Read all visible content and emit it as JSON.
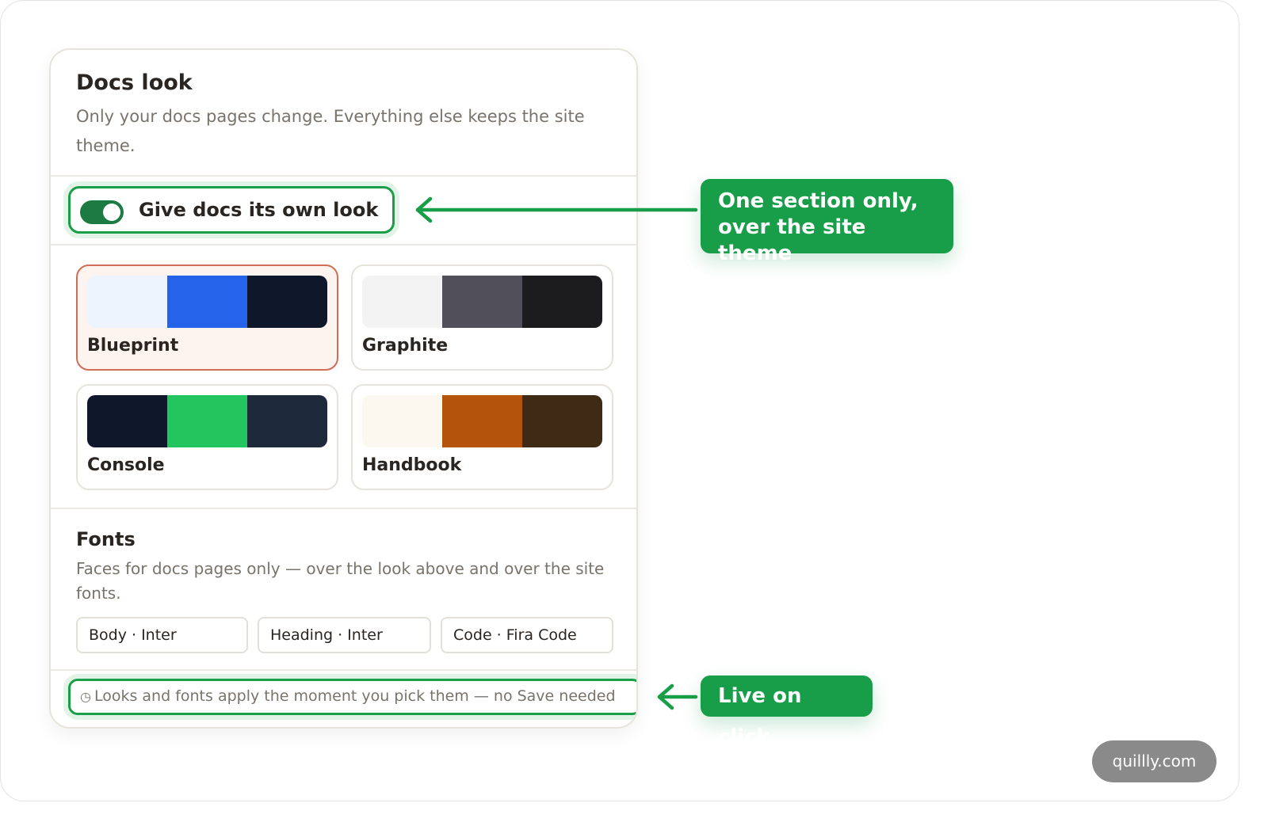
{
  "panel": {
    "title": "Docs look",
    "description": "Only your docs pages change. Everything else keeps the site theme.",
    "toggle_label": "Give docs its own look",
    "toggle_on": true
  },
  "looks": [
    {
      "name": "Blueprint",
      "selected": true,
      "colors": [
        "#eef4fe",
        "#2563eb",
        "#0f172a"
      ]
    },
    {
      "name": "Graphite",
      "selected": false,
      "colors": [
        "#f3f3f3",
        "#51505a",
        "#1c1c1e"
      ]
    },
    {
      "name": "Console",
      "selected": false,
      "colors": [
        "#0f172a",
        "#22c55e",
        "#1e293b"
      ]
    },
    {
      "name": "Handbook",
      "selected": false,
      "colors": [
        "#fdf8ef",
        "#b4530a",
        "#3f2a15"
      ]
    }
  ],
  "fonts": {
    "title": "Fonts",
    "description": "Faces for docs pages only — over the look above and over the site fonts.",
    "chips": [
      "Body · Inter",
      "Heading · Inter",
      "Code · Fira Code"
    ]
  },
  "note": {
    "icon": "clock-icon",
    "glyph": "◷",
    "text": "Looks and fonts apply the moment you pick them — no Save needed"
  },
  "callouts": {
    "section": "One section only, over the site theme",
    "live": "Live on click"
  },
  "brand": "quillly.com",
  "colors": {
    "accent": "#189d49",
    "selected_border": "#cf6d57",
    "toggle": "#1c7a43"
  }
}
